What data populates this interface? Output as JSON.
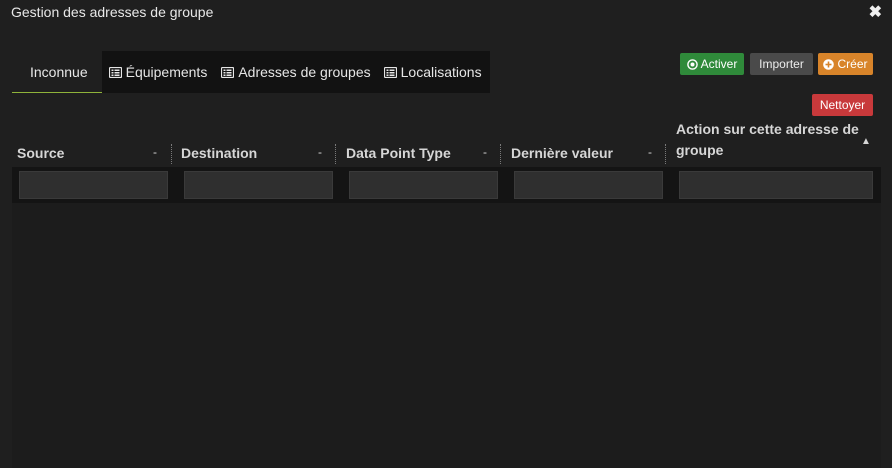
{
  "window": {
    "title": "Gestion des adresses de groupe",
    "close_icon": "close-icon",
    "close_glyph": "✖"
  },
  "tabs": [
    {
      "label": "Inconnue",
      "active": true,
      "icon": ""
    },
    {
      "label": "Équipements",
      "active": false,
      "icon": "list-icon"
    },
    {
      "label": "Adresses de groupes",
      "active": false,
      "icon": "list-icon"
    },
    {
      "label": "Localisations",
      "active": false,
      "icon": "list-icon"
    }
  ],
  "actions": {
    "activer": {
      "label": "Activer",
      "icon": "target-icon",
      "color": "#2f8a3a"
    },
    "importer": {
      "label": "Importer",
      "color": "#4a4a4a"
    },
    "creer": {
      "label": "Créer",
      "icon": "plus-circle-icon",
      "color": "#d8842a"
    },
    "nettoyer": {
      "label": "Nettoyer",
      "color": "#c8393b"
    }
  },
  "table": {
    "columns": [
      {
        "label": "Source",
        "sort": "-"
      },
      {
        "label": "Destination",
        "sort": "-"
      },
      {
        "label": "Data Point Type",
        "sort": "-"
      },
      {
        "label": "Dernière valeur",
        "sort": "-"
      },
      {
        "label": "Action sur cette adresse de groupe",
        "sort": "▲"
      }
    ],
    "filters": [
      "",
      "",
      "",
      "",
      ""
    ],
    "rows": []
  },
  "colors": {
    "background": "#1f1f1f",
    "active_tab_underline": "#8fb33a"
  }
}
